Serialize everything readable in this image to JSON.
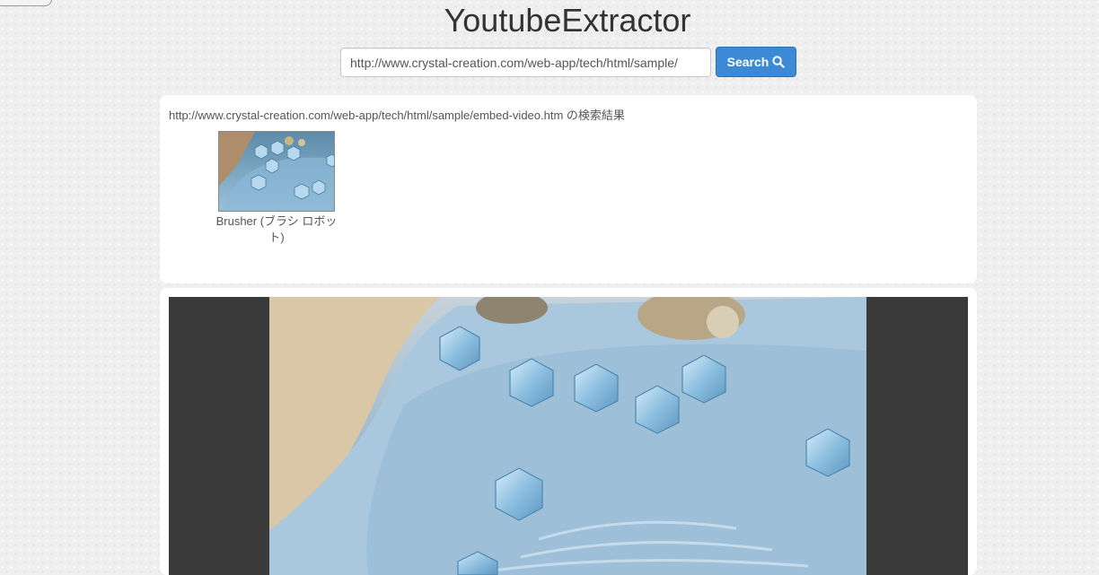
{
  "app": {
    "title": "YoutubeExtractor"
  },
  "search": {
    "value": "http://www.crystal-creation.com/web-app/tech/html/sample/",
    "button_label": "Search",
    "button_icon": "search-icon"
  },
  "results": {
    "heading": "http://www.crystal-creation.com/web-app/tech/html/sample/embed-video.htm の検索結果",
    "items": [
      {
        "title": "Brusher (ブラシ ロボット)"
      }
    ]
  },
  "colors": {
    "accent": "#3c8ad6",
    "player_background": "#3a3a3a",
    "page_background": "#efefef"
  }
}
